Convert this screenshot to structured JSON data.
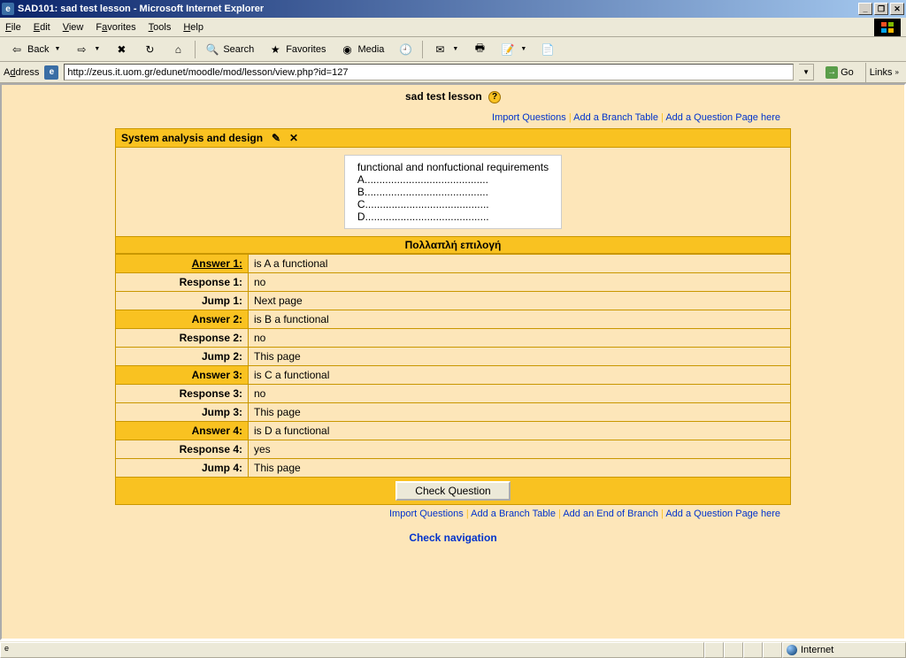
{
  "window": {
    "title": "SAD101: sad test lesson - Microsoft Internet Explorer"
  },
  "menu": {
    "file": "File",
    "edit": "Edit",
    "view": "View",
    "favorites": "Favorites",
    "tools": "Tools",
    "help": "Help"
  },
  "toolbar": {
    "back": "Back",
    "search": "Search",
    "favorites": "Favorites",
    "media": "Media"
  },
  "addressbar": {
    "label": "Address",
    "url": "http://zeus.it.uom.gr/edunet/moodle/mod/lesson/view.php?id=127",
    "go": "Go",
    "links": "Links"
  },
  "page": {
    "title": "sad test lesson",
    "links_top": {
      "import": "Import Questions",
      "branch": "Add a Branch Table",
      "question": "Add a Question Page here"
    },
    "section_title": "System analysis and design",
    "question_box": {
      "title": "functional and nonfuctional requirements",
      "a": "A..........................................",
      "b": "B..........................................",
      "c": "C..........................................",
      "d": "D.........................................."
    },
    "qtype": "Πολλαπλή επιλογή",
    "rows": [
      {
        "label": "Answer 1:",
        "val": "is A a functional",
        "hl": true,
        "u": true
      },
      {
        "label": "Response 1:",
        "val": "no",
        "hl": false
      },
      {
        "label": "Jump 1:",
        "val": "Next page",
        "hl": false
      },
      {
        "label": "Answer 2:",
        "val": "is B a functional",
        "hl": true
      },
      {
        "label": "Response 2:",
        "val": "no",
        "hl": false
      },
      {
        "label": "Jump 2:",
        "val": "This page",
        "hl": false
      },
      {
        "label": "Answer 3:",
        "val": "is C a functional",
        "hl": true
      },
      {
        "label": "Response 3:",
        "val": "no",
        "hl": false
      },
      {
        "label": "Jump 3:",
        "val": "This page",
        "hl": false
      },
      {
        "label": "Answer 4:",
        "val": "is D a functional",
        "hl": true
      },
      {
        "label": "Response 4:",
        "val": "yes",
        "hl": false
      },
      {
        "label": "Jump 4:",
        "val": "This page",
        "hl": false
      }
    ],
    "check_btn": "Check Question",
    "links_bottom": {
      "import": "Import Questions",
      "branch": "Add a Branch Table",
      "endbranch": "Add an End of Branch",
      "question": "Add a Question Page here"
    },
    "check_nav": "Check navigation"
  },
  "statusbar": {
    "zone": "Internet"
  }
}
